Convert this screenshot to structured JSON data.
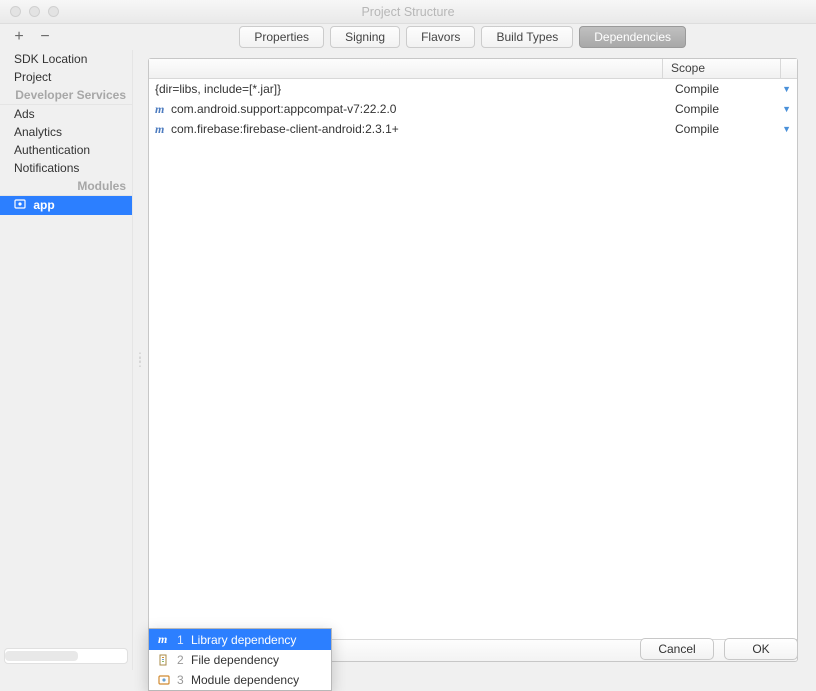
{
  "window": {
    "title": "Project Structure"
  },
  "tabs": [
    {
      "label": "Properties",
      "selected": false
    },
    {
      "label": "Signing",
      "selected": false
    },
    {
      "label": "Flavors",
      "selected": false
    },
    {
      "label": "Build Types",
      "selected": false
    },
    {
      "label": "Dependencies",
      "selected": true
    }
  ],
  "sidebar": {
    "items": [
      {
        "label": "SDK Location",
        "type": "item"
      },
      {
        "label": "Project",
        "type": "item"
      },
      {
        "label": "Developer Services",
        "type": "heading"
      },
      {
        "label": "Ads",
        "type": "item"
      },
      {
        "label": "Analytics",
        "type": "item"
      },
      {
        "label": "Authentication",
        "type": "item"
      },
      {
        "label": "Notifications",
        "type": "item"
      },
      {
        "label": "Modules",
        "type": "heading"
      },
      {
        "label": "app",
        "type": "module",
        "selected": true
      }
    ]
  },
  "deps": {
    "header_main": "",
    "header_scope": "Scope",
    "rows": [
      {
        "icon": "none",
        "label": "{dir=libs, include=[*.jar]}",
        "scope": "Compile"
      },
      {
        "icon": "m",
        "label": "com.android.support:appcompat-v7:22.2.0",
        "scope": "Compile"
      },
      {
        "icon": "m",
        "label": "com.firebase:firebase-client-android:2.3.1+",
        "scope": "Compile"
      }
    ]
  },
  "popup": {
    "items": [
      {
        "num": "1",
        "label": "Library dependency",
        "icon": "m",
        "selected": true
      },
      {
        "num": "2",
        "label": "File dependency",
        "icon": "file"
      },
      {
        "num": "3",
        "label": "Module dependency",
        "icon": "module"
      }
    ]
  },
  "buttons": {
    "cancel": "Cancel",
    "ok": "OK"
  }
}
